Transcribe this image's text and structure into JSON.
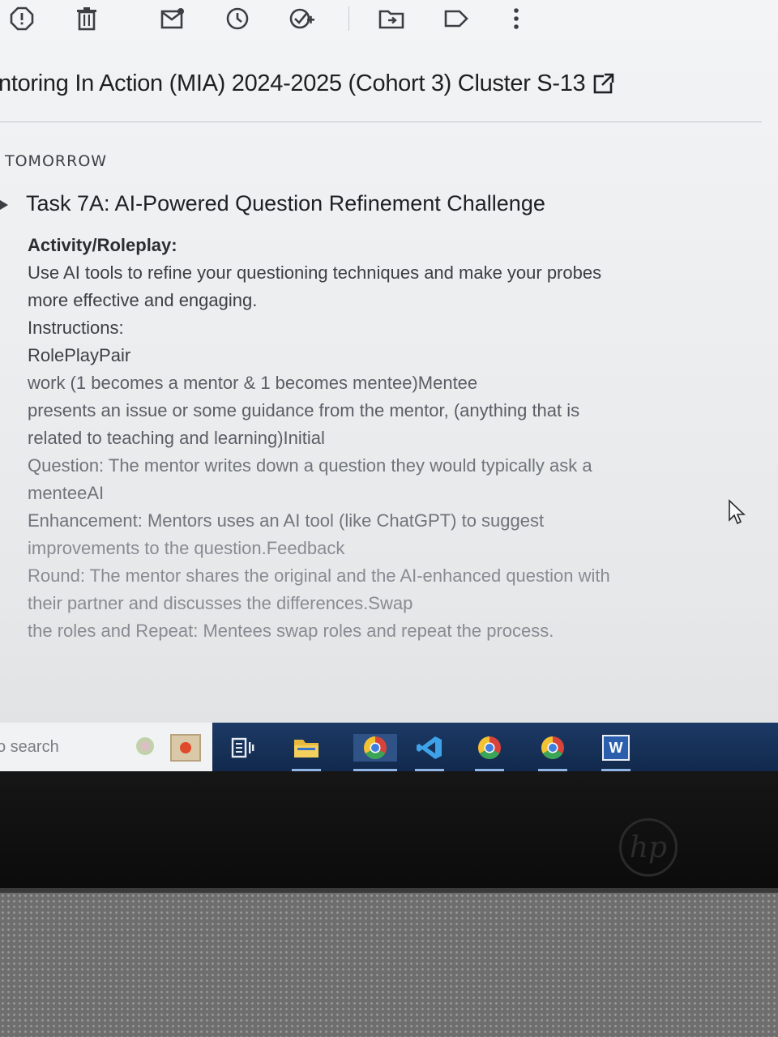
{
  "toolbar": {
    "icons": [
      "report-icon",
      "delete-icon",
      "mark-unread-icon",
      "snooze-icon",
      "add-to-tasks-icon",
      "move-to-icon",
      "label-icon",
      "more-vert-icon"
    ]
  },
  "header": {
    "title": "ntoring In Action (MIA) 2024-2025 (Cohort 3) Cluster S-13"
  },
  "section": {
    "label": "TOMORROW"
  },
  "task": {
    "title": "Task 7A: AI-Powered Question Refinement Challenge",
    "subheading": "Activity/Roleplay:",
    "lines": [
      "Use AI tools to refine your questioning techniques and make your probes",
      "more effective and engaging.",
      "Instructions:",
      "RolePlayPair",
      "work (1 becomes a mentor & 1 becomes mentee)Mentee",
      "presents an issue or some guidance from the mentor, (anything that is",
      "related to teaching and learning)Initial",
      "Question: The mentor writes down a question they would typically ask a",
      "menteeAI",
      "Enhancement: Mentors uses an AI tool (like ChatGPT) to suggest",
      "improvements to the question.Feedback",
      "Round: The mentor shares the original and the AI-enhanced question with",
      "their partner and discusses the differences.Swap",
      "the roles and Repeat: Mentees swap roles and repeat the process."
    ]
  },
  "taskbar": {
    "search_text": "o search",
    "apps": [
      "cortana-icon",
      "photo-app-icon",
      "task-view-icon",
      "file-explorer-icon",
      "chrome-icon",
      "vscode-icon",
      "chrome-icon-2",
      "chrome-icon-3",
      "word-icon"
    ],
    "word_label": "W"
  },
  "device": {
    "brand": "hp"
  },
  "colors": {
    "taskbar": "#1c3a66",
    "text": "#3c4043"
  }
}
